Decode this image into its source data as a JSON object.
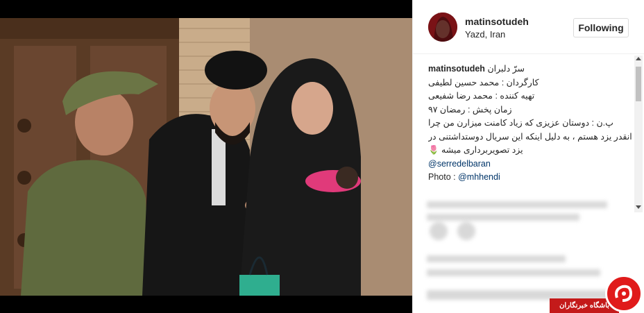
{
  "post": {
    "username": "matinsotudeh",
    "location": "Yazd, Iran",
    "follow_label": "Following",
    "avatar_icon": "profile-avatar"
  },
  "caption": {
    "lines": [
      "سرّ دلبران",
      "کارگردان : محمد حسین لطیفی",
      "تهیه کننده : محمد رضا شفیعی",
      "زمان پخش : رمضان ۹۷",
      "پ.ن : دوستان عزیزی که زیاد کامنت میزارن من چرا",
      "انقدر یزد هستم ، به دلیل اینکه این سریال دوستداشتنی در",
      "یزد تصویربرداری میشه 🌷"
    ],
    "mention": "@serredelbaran",
    "photo_prefix": "Photo : ",
    "photo_credit": "@mhhendi"
  },
  "watermark": {
    "text": "باشگاه خبرنگاران"
  },
  "colors": {
    "link": "#003569",
    "text": "#262626",
    "watermark_red": "#c41a1a"
  }
}
